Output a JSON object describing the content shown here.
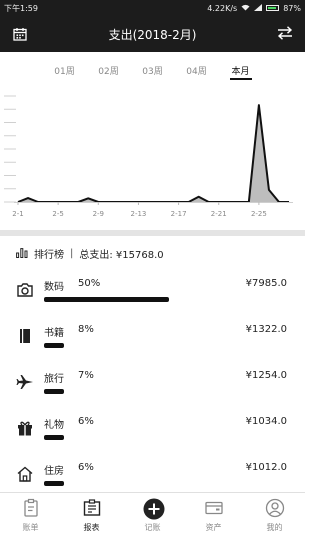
{
  "status_bar": {
    "time": "下午1:59",
    "network_speed": "4.22K/s",
    "battery_text": "87%",
    "battery_level": 0.87
  },
  "header": {
    "title": "支出(2018-2月)",
    "left_icon": "calendar-icon",
    "right_icon": "swap-icon"
  },
  "period_tabs": [
    {
      "label": "01周",
      "active": false
    },
    {
      "label": "02周",
      "active": false
    },
    {
      "label": "03周",
      "active": false
    },
    {
      "label": "04周",
      "active": false
    },
    {
      "label": "本月",
      "active": true
    }
  ],
  "chart_data": {
    "type": "area",
    "x_tick_labels": [
      "2-1",
      "2-5",
      "2-9",
      "2-13",
      "2-17",
      "2-21",
      "2-25"
    ],
    "days": [
      "2-1",
      "2-2",
      "2-3",
      "2-4",
      "2-5",
      "2-6",
      "2-7",
      "2-8",
      "2-9",
      "2-10",
      "2-11",
      "2-12",
      "2-13",
      "2-14",
      "2-15",
      "2-16",
      "2-17",
      "2-18",
      "2-19",
      "2-20",
      "2-21",
      "2-22",
      "2-23",
      "2-24",
      "2-25",
      "2-26",
      "2-27",
      "2-28"
    ],
    "values": [
      0,
      520,
      0,
      0,
      0,
      0,
      0,
      480,
      0,
      0,
      0,
      0,
      0,
      0,
      0,
      0,
      0,
      0,
      700,
      0,
      0,
      0,
      0,
      0,
      12800,
      1600,
      0,
      0
    ],
    "ylim": [
      0,
      14000
    ],
    "grid": true,
    "fill_color": "#bdbdbd",
    "line_color": "#111111"
  },
  "ranking": {
    "title": "排行榜",
    "total_label": "总支出: ¥15768.0",
    "items": [
      {
        "icon": "camera-icon",
        "name": "数码",
        "percent": "50%",
        "amount": "¥7985.0",
        "share": 0.5
      },
      {
        "icon": "book-icon",
        "name": "书籍",
        "percent": "8%",
        "amount": "¥1322.0",
        "share": 0.08
      },
      {
        "icon": "airplane-icon",
        "name": "旅行",
        "percent": "7%",
        "amount": "¥1254.0",
        "share": 0.07
      },
      {
        "icon": "gift-icon",
        "name": "礼物",
        "percent": "6%",
        "amount": "¥1034.0",
        "share": 0.06
      },
      {
        "icon": "house-icon",
        "name": "住房",
        "percent": "6%",
        "amount": "¥1012.0",
        "share": 0.06
      }
    ]
  },
  "bottom_tabs": [
    {
      "label": "账单",
      "icon": "clipboard-icon",
      "active": false
    },
    {
      "label": "报表",
      "icon": "report-icon",
      "active": true
    },
    {
      "label": "记账",
      "icon": "add-circle-icon",
      "active": false
    },
    {
      "label": "资产",
      "icon": "wallet-icon",
      "active": false
    },
    {
      "label": "我的",
      "icon": "profile-icon",
      "active": false
    }
  ],
  "colors": {
    "header_bg": "#1c1c1c",
    "accent": "#111111",
    "inactive_text": "#888888"
  }
}
